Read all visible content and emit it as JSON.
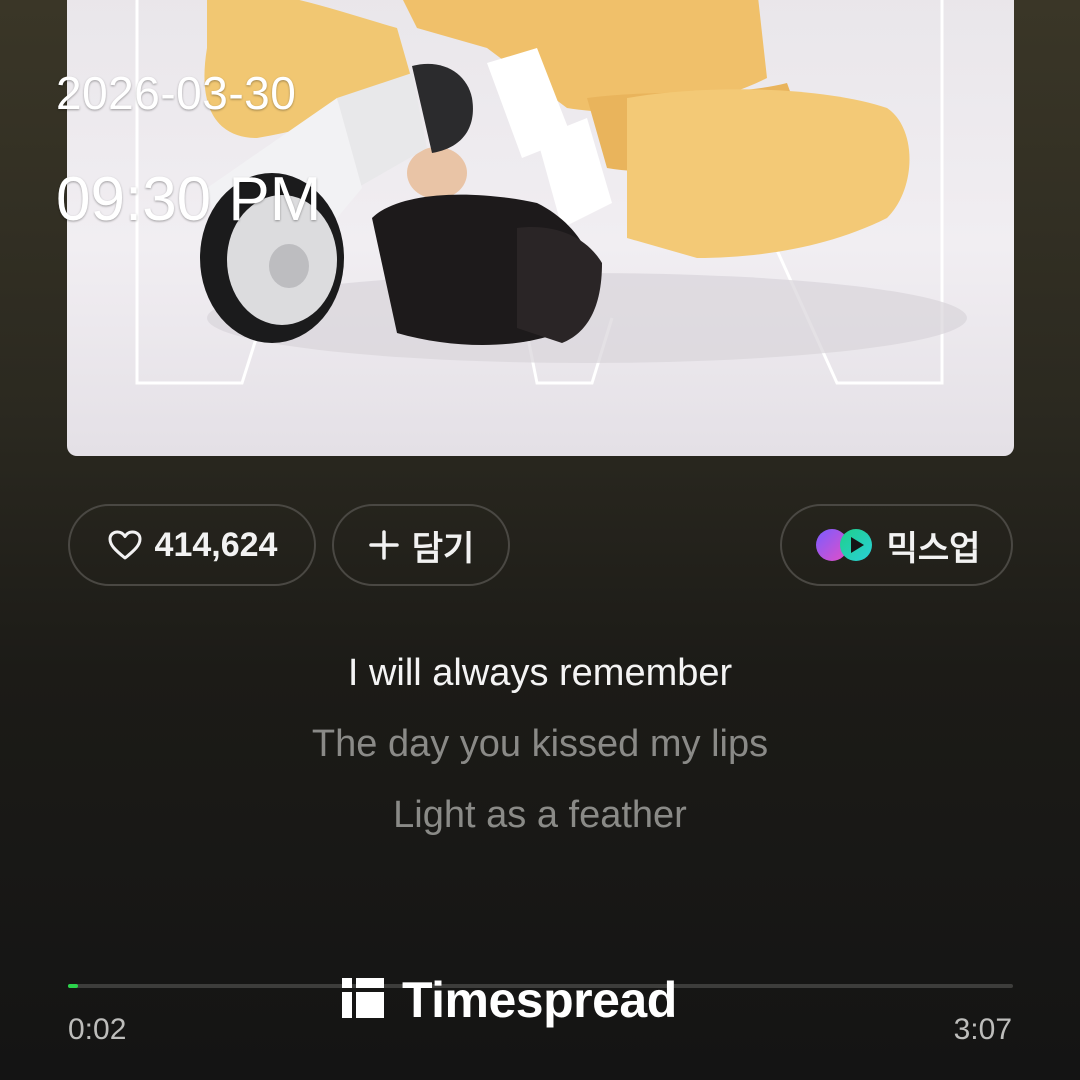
{
  "overlay": {
    "date": "2026-03-30",
    "time": "09:30 PM"
  },
  "actions": {
    "like_count": "414,624",
    "add_label": "담기",
    "mixup_label": "믹스업"
  },
  "lyrics": [
    {
      "text": "I will always remember",
      "state": "active"
    },
    {
      "text": "The day you kissed my lips",
      "state": "upcoming"
    },
    {
      "text": "Light as a feather",
      "state": "upcoming"
    }
  ],
  "player": {
    "current_time": "0:02",
    "total_time": "3:07",
    "progress_fraction": 0.011,
    "accent_color": "#2bd24b"
  },
  "watermark": {
    "text": "Timespread"
  },
  "icons": [
    "heart-icon",
    "plus-icon",
    "mixup-icon",
    "timespread-logo-icon"
  ]
}
